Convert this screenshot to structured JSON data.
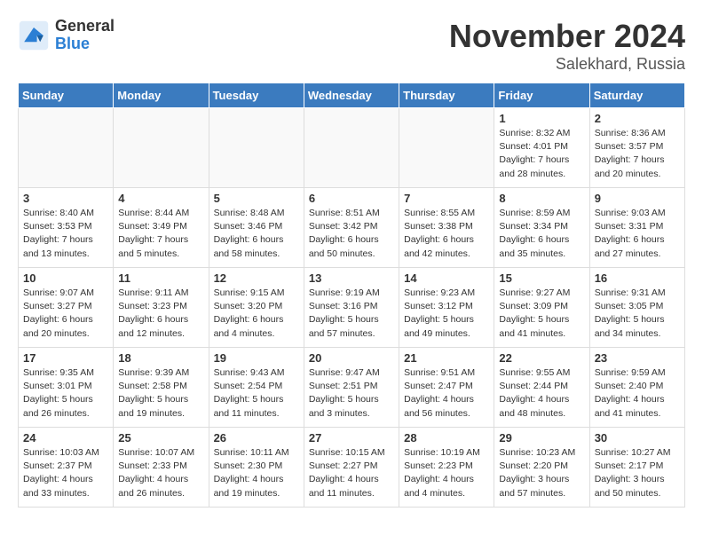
{
  "header": {
    "logo_general": "General",
    "logo_blue": "Blue",
    "month_title": "November 2024",
    "location": "Salekhard, Russia"
  },
  "days_of_week": [
    "Sunday",
    "Monday",
    "Tuesday",
    "Wednesday",
    "Thursday",
    "Friday",
    "Saturday"
  ],
  "weeks": [
    [
      {
        "day": "",
        "info": ""
      },
      {
        "day": "",
        "info": ""
      },
      {
        "day": "",
        "info": ""
      },
      {
        "day": "",
        "info": ""
      },
      {
        "day": "",
        "info": ""
      },
      {
        "day": "1",
        "info": "Sunrise: 8:32 AM\nSunset: 4:01 PM\nDaylight: 7 hours and 28 minutes."
      },
      {
        "day": "2",
        "info": "Sunrise: 8:36 AM\nSunset: 3:57 PM\nDaylight: 7 hours and 20 minutes."
      }
    ],
    [
      {
        "day": "3",
        "info": "Sunrise: 8:40 AM\nSunset: 3:53 PM\nDaylight: 7 hours and 13 minutes."
      },
      {
        "day": "4",
        "info": "Sunrise: 8:44 AM\nSunset: 3:49 PM\nDaylight: 7 hours and 5 minutes."
      },
      {
        "day": "5",
        "info": "Sunrise: 8:48 AM\nSunset: 3:46 PM\nDaylight: 6 hours and 58 minutes."
      },
      {
        "day": "6",
        "info": "Sunrise: 8:51 AM\nSunset: 3:42 PM\nDaylight: 6 hours and 50 minutes."
      },
      {
        "day": "7",
        "info": "Sunrise: 8:55 AM\nSunset: 3:38 PM\nDaylight: 6 hours and 42 minutes."
      },
      {
        "day": "8",
        "info": "Sunrise: 8:59 AM\nSunset: 3:34 PM\nDaylight: 6 hours and 35 minutes."
      },
      {
        "day": "9",
        "info": "Sunrise: 9:03 AM\nSunset: 3:31 PM\nDaylight: 6 hours and 27 minutes."
      }
    ],
    [
      {
        "day": "10",
        "info": "Sunrise: 9:07 AM\nSunset: 3:27 PM\nDaylight: 6 hours and 20 minutes."
      },
      {
        "day": "11",
        "info": "Sunrise: 9:11 AM\nSunset: 3:23 PM\nDaylight: 6 hours and 12 minutes."
      },
      {
        "day": "12",
        "info": "Sunrise: 9:15 AM\nSunset: 3:20 PM\nDaylight: 6 hours and 4 minutes."
      },
      {
        "day": "13",
        "info": "Sunrise: 9:19 AM\nSunset: 3:16 PM\nDaylight: 5 hours and 57 minutes."
      },
      {
        "day": "14",
        "info": "Sunrise: 9:23 AM\nSunset: 3:12 PM\nDaylight: 5 hours and 49 minutes."
      },
      {
        "day": "15",
        "info": "Sunrise: 9:27 AM\nSunset: 3:09 PM\nDaylight: 5 hours and 41 minutes."
      },
      {
        "day": "16",
        "info": "Sunrise: 9:31 AM\nSunset: 3:05 PM\nDaylight: 5 hours and 34 minutes."
      }
    ],
    [
      {
        "day": "17",
        "info": "Sunrise: 9:35 AM\nSunset: 3:01 PM\nDaylight: 5 hours and 26 minutes."
      },
      {
        "day": "18",
        "info": "Sunrise: 9:39 AM\nSunset: 2:58 PM\nDaylight: 5 hours and 19 minutes."
      },
      {
        "day": "19",
        "info": "Sunrise: 9:43 AM\nSunset: 2:54 PM\nDaylight: 5 hours and 11 minutes."
      },
      {
        "day": "20",
        "info": "Sunrise: 9:47 AM\nSunset: 2:51 PM\nDaylight: 5 hours and 3 minutes."
      },
      {
        "day": "21",
        "info": "Sunrise: 9:51 AM\nSunset: 2:47 PM\nDaylight: 4 hours and 56 minutes."
      },
      {
        "day": "22",
        "info": "Sunrise: 9:55 AM\nSunset: 2:44 PM\nDaylight: 4 hours and 48 minutes."
      },
      {
        "day": "23",
        "info": "Sunrise: 9:59 AM\nSunset: 2:40 PM\nDaylight: 4 hours and 41 minutes."
      }
    ],
    [
      {
        "day": "24",
        "info": "Sunrise: 10:03 AM\nSunset: 2:37 PM\nDaylight: 4 hours and 33 minutes."
      },
      {
        "day": "25",
        "info": "Sunrise: 10:07 AM\nSunset: 2:33 PM\nDaylight: 4 hours and 26 minutes."
      },
      {
        "day": "26",
        "info": "Sunrise: 10:11 AM\nSunset: 2:30 PM\nDaylight: 4 hours and 19 minutes."
      },
      {
        "day": "27",
        "info": "Sunrise: 10:15 AM\nSunset: 2:27 PM\nDaylight: 4 hours and 11 minutes."
      },
      {
        "day": "28",
        "info": "Sunrise: 10:19 AM\nSunset: 2:23 PM\nDaylight: 4 hours and 4 minutes."
      },
      {
        "day": "29",
        "info": "Sunrise: 10:23 AM\nSunset: 2:20 PM\nDaylight: 3 hours and 57 minutes."
      },
      {
        "day": "30",
        "info": "Sunrise: 10:27 AM\nSunset: 2:17 PM\nDaylight: 3 hours and 50 minutes."
      }
    ]
  ]
}
